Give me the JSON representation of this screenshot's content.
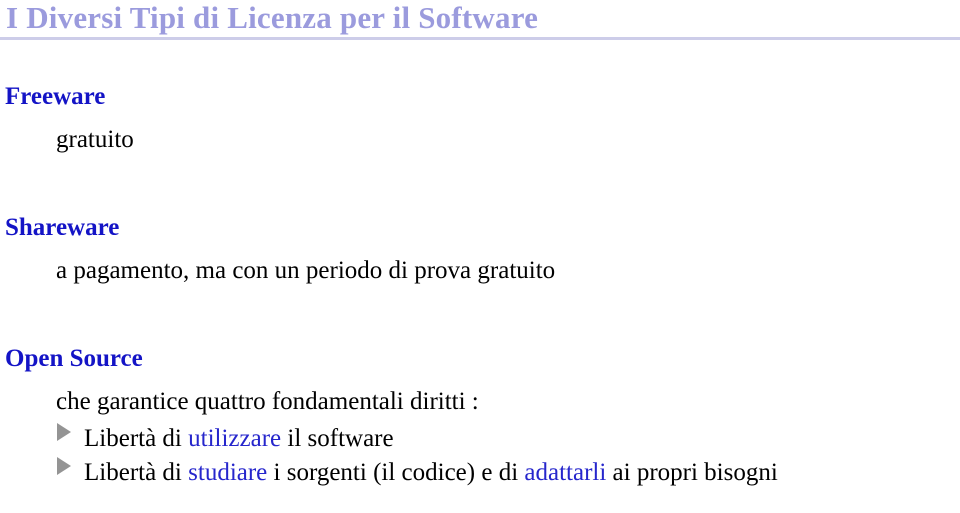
{
  "slide": {
    "title": "I Diversi Tipi di Licenza per il Software",
    "colors": {
      "title": "#9b9bdd",
      "rule": "#cdcde9",
      "heading": "#1414c6",
      "keyword": "#2626cc",
      "bullet_marker": "#949494",
      "body_text": "#000000",
      "background": "#ffffff"
    },
    "sections": [
      {
        "heading": "Freeware",
        "body": "gratuito"
      },
      {
        "heading": "Shareware",
        "body": "a pagamento, ma con un periodo di prova gratuito"
      },
      {
        "heading": "Open Source",
        "body": "che garantice quattro fondamentali diritti :"
      }
    ],
    "bullets": [
      {
        "marker": "triangle-right-icon",
        "part1": "Libertà di ",
        "keyword1": "utilizzare",
        "part2": " il software",
        "keyword2": "",
        "part3": ""
      },
      {
        "marker": "triangle-right-icon",
        "part1": "Libertà di ",
        "keyword1": "studiare",
        "part2": " i sorgenti (il codice) e di ",
        "keyword2": "adattarli",
        "part3": " ai propri bisogni"
      }
    ]
  }
}
